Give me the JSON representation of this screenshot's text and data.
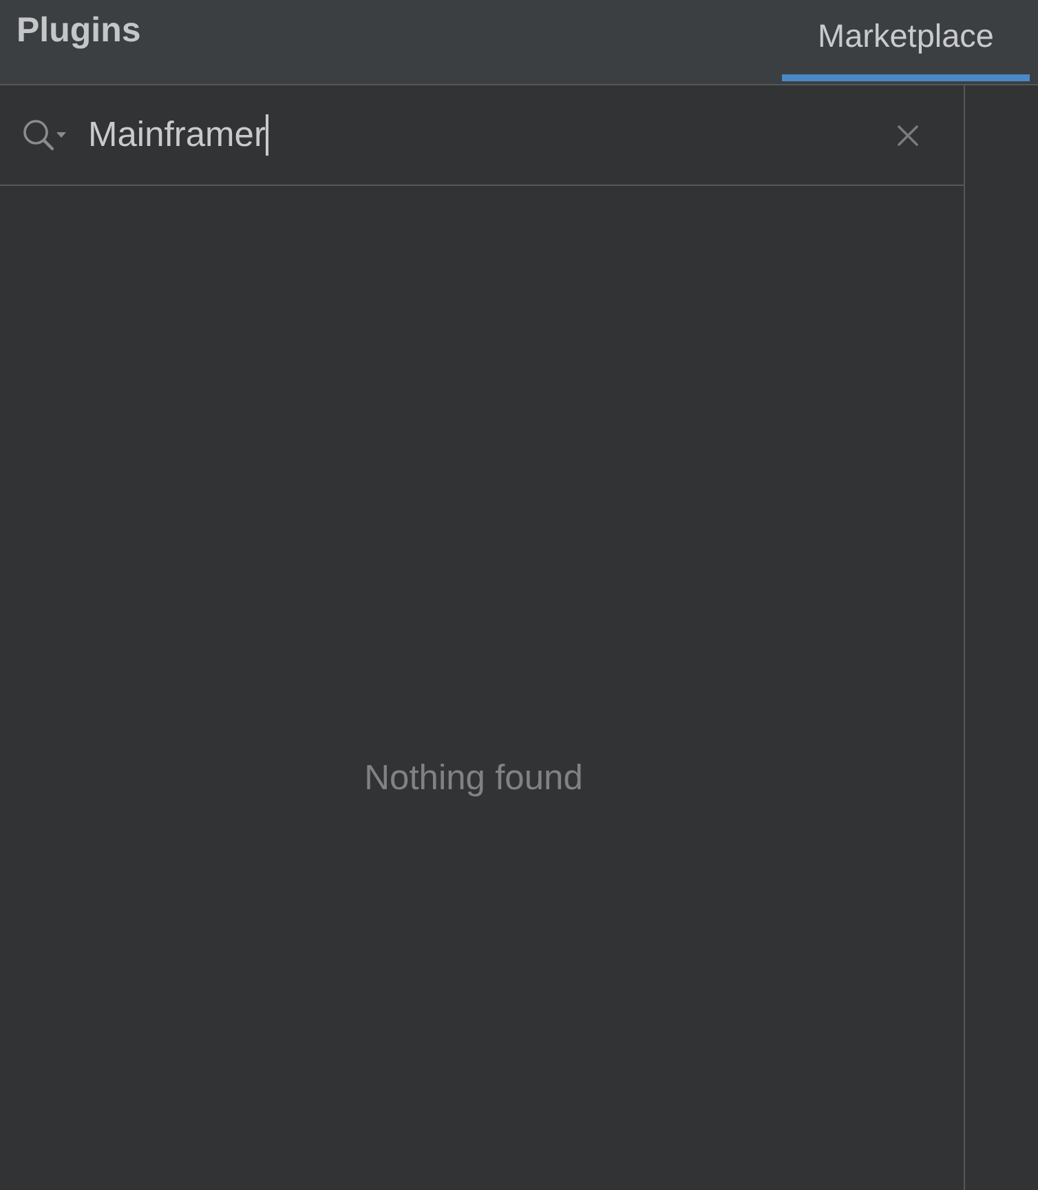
{
  "header": {
    "title": "Plugins"
  },
  "tabs": [
    {
      "label": "Marketplace",
      "selected": true
    }
  ],
  "search": {
    "value": "Mainframer",
    "focused": true
  },
  "results": {
    "empty_message": "Nothing found"
  }
}
